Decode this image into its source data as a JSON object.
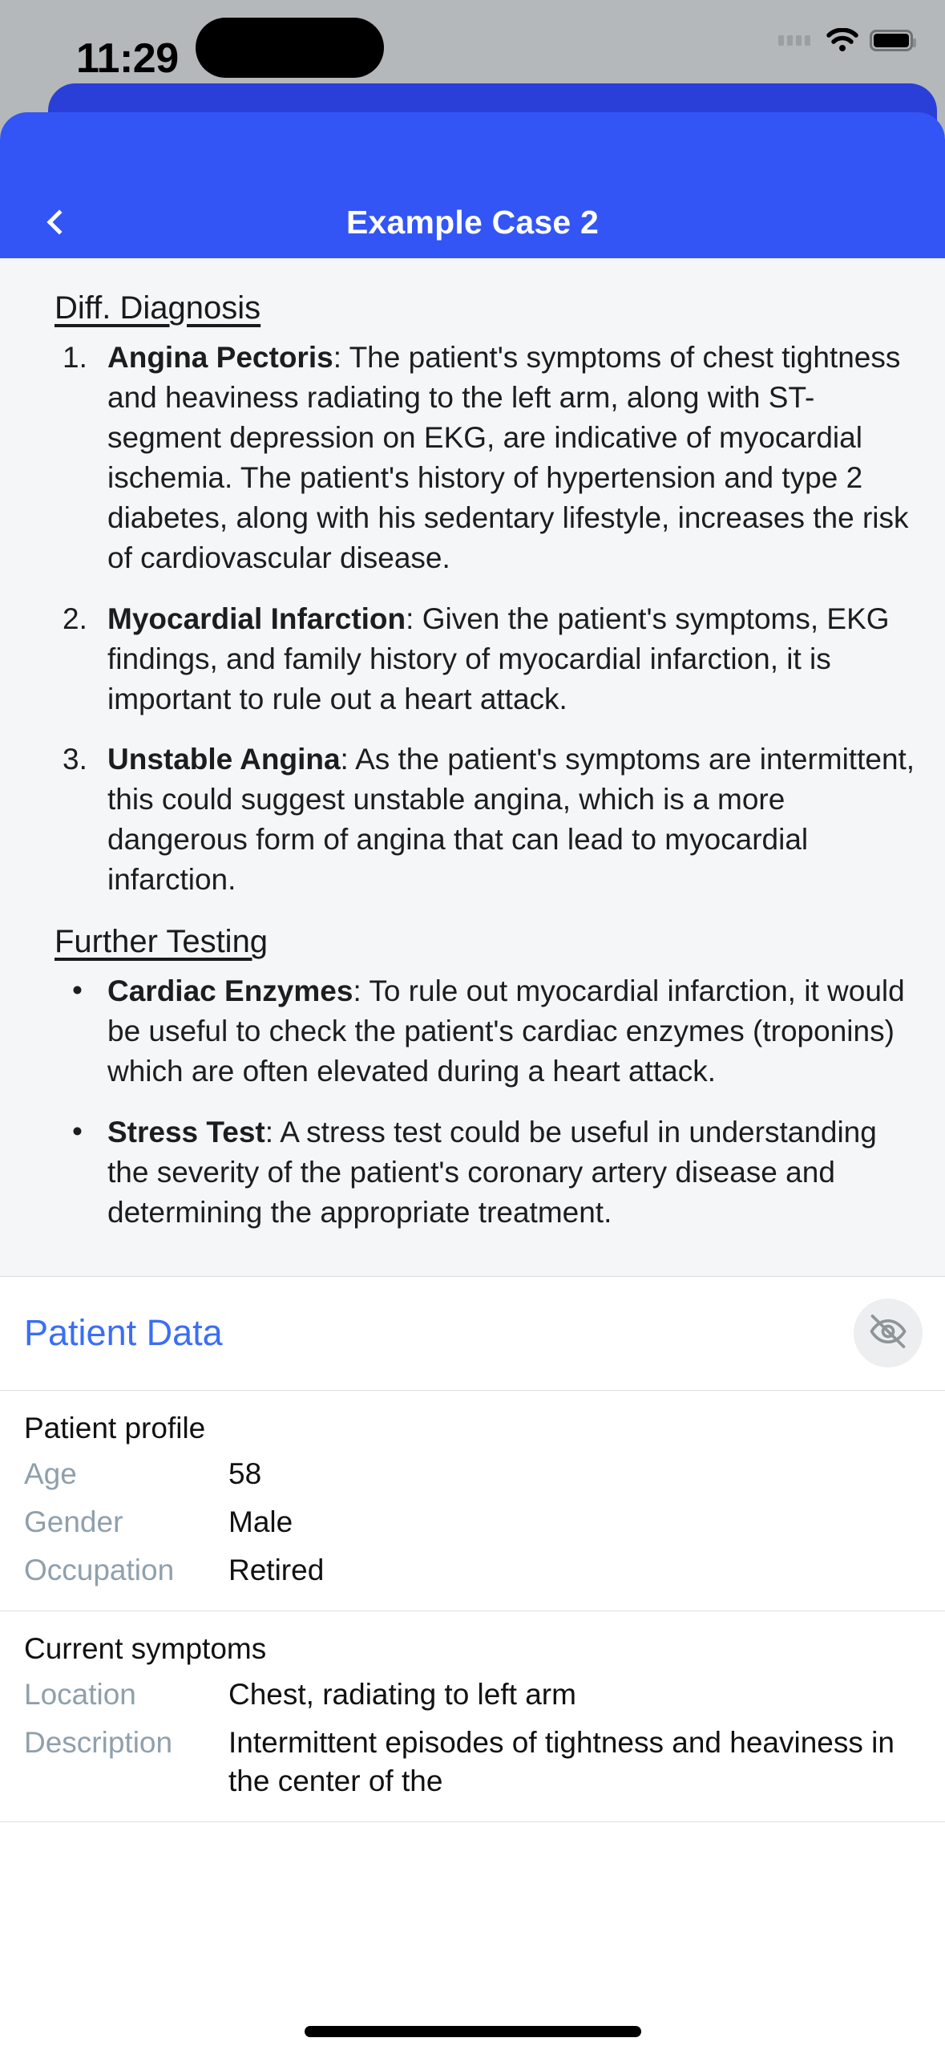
{
  "status_bar": {
    "time": "11:29",
    "wifi_icon": "wifi-icon",
    "battery_icon": "battery-icon",
    "signal_icon": "signal-dots-icon"
  },
  "nav": {
    "title": "Example Case 2",
    "back_icon": "chevron-left-icon"
  },
  "note": {
    "diagnosis_heading": "Diff. Diagnosis",
    "diagnosis_items": [
      {
        "marker": "1.",
        "term": "Angina Pectoris",
        "text": ": The patient's symptoms of chest tightness and heaviness radiating to the left arm, along with ST-segment depression on EKG, are indicative of myocardial ischemia. The patient's history of hypertension and type 2 diabetes, along with his sedentary lifestyle, increases the risk of cardiovascular disease."
      },
      {
        "marker": "2.",
        "term": "Myocardial Infarction",
        "text": ": Given the patient's symptoms, EKG findings, and family history of myocardial infarction, it is important to rule out a heart attack."
      },
      {
        "marker": "3.",
        "term": "Unstable Angina",
        "text": ": As the patient's symptoms are intermittent, this could suggest unstable angina, which is a more dangerous form of angina that can lead to myocardial infarction."
      }
    ],
    "testing_heading": "Further Testing",
    "testing_items": [
      {
        "marker": "•",
        "term": "Cardiac Enzymes",
        "text": ": To rule out myocardial infarction, it would be useful to check the patient's cardiac enzymes (troponins) which are often elevated during a heart attack."
      },
      {
        "marker": "•",
        "term": "Stress Test",
        "text": ": A stress test could be useful in understanding the severity of the patient's coronary artery disease and determining the appropriate treatment."
      }
    ]
  },
  "patient_data": {
    "title": "Patient Data",
    "hide_icon": "eye-off-icon",
    "sections": [
      {
        "title": "Patient profile",
        "rows": [
          {
            "key": "Age",
            "value": "58"
          },
          {
            "key": "Gender",
            "value": "Male"
          },
          {
            "key": "Occupation",
            "value": "Retired"
          }
        ]
      },
      {
        "title": "Current symptoms",
        "rows": [
          {
            "key": "Location",
            "value": "Chest, radiating to left arm"
          },
          {
            "key": "Description",
            "value": "Intermittent episodes of tightness and heaviness in the center of the"
          }
        ]
      }
    ]
  },
  "colors": {
    "accent_blue": "#3355f5",
    "accent_blue_dark": "#2a3fd8",
    "link_blue": "#3b6ef5",
    "note_bg": "#f4f6f8",
    "key_gray": "#8fa0ac"
  }
}
